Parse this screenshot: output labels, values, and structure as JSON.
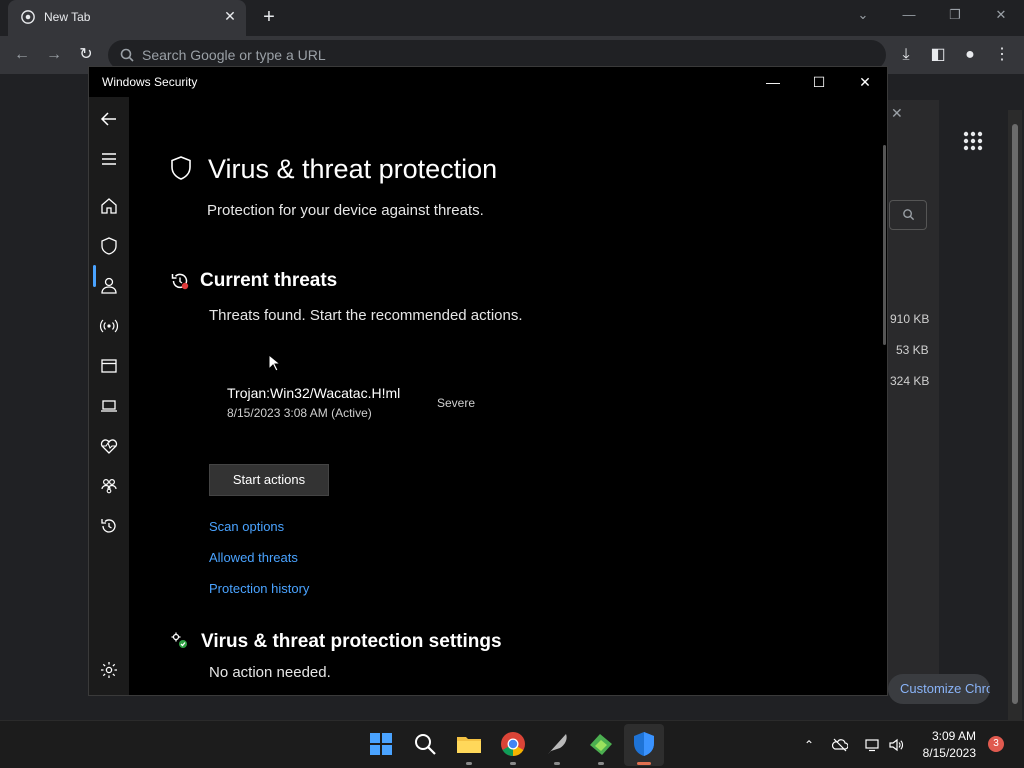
{
  "browser": {
    "tab_title": "New Tab",
    "omnibox_placeholder": "Search Google or type a URL",
    "customize_label": "Customize Chrome",
    "download_sizes": [
      "910 KB",
      "53 KB",
      "324 KB"
    ]
  },
  "security_window": {
    "title": "Windows Security",
    "page_title": "Virus & threat protection",
    "page_subtitle": "Protection for your device against threats.",
    "current_threats": {
      "title": "Current threats",
      "status": "Threats found. Start the recommended actions.",
      "threat": {
        "name": "Trojan:Win32/Wacatac.H!ml",
        "time": "8/15/2023 3:08 AM (Active)",
        "severity": "Severe"
      },
      "start_actions_label": "Start actions",
      "links": [
        "Scan options",
        "Allowed threats",
        "Protection history"
      ]
    },
    "settings": {
      "title": "Virus & threat protection settings",
      "status": "No action needed."
    },
    "nav": [
      "back-icon",
      "menu-icon",
      "home-icon",
      "shield-icon",
      "account-icon",
      "network-icon",
      "app-browser-icon",
      "device-security-icon",
      "device-health-icon",
      "family-icon",
      "history-icon",
      "settings-icon"
    ],
    "accent_color": "#4aa3ff"
  },
  "taskbar": {
    "time": "3:09 AM",
    "date": "8/15/2023",
    "notification_count": "3",
    "apps": [
      "start-icon",
      "search-icon",
      "file-explorer-icon",
      "chrome-icon",
      "feather-app-icon",
      "green-app-icon",
      "windows-security-icon"
    ]
  }
}
